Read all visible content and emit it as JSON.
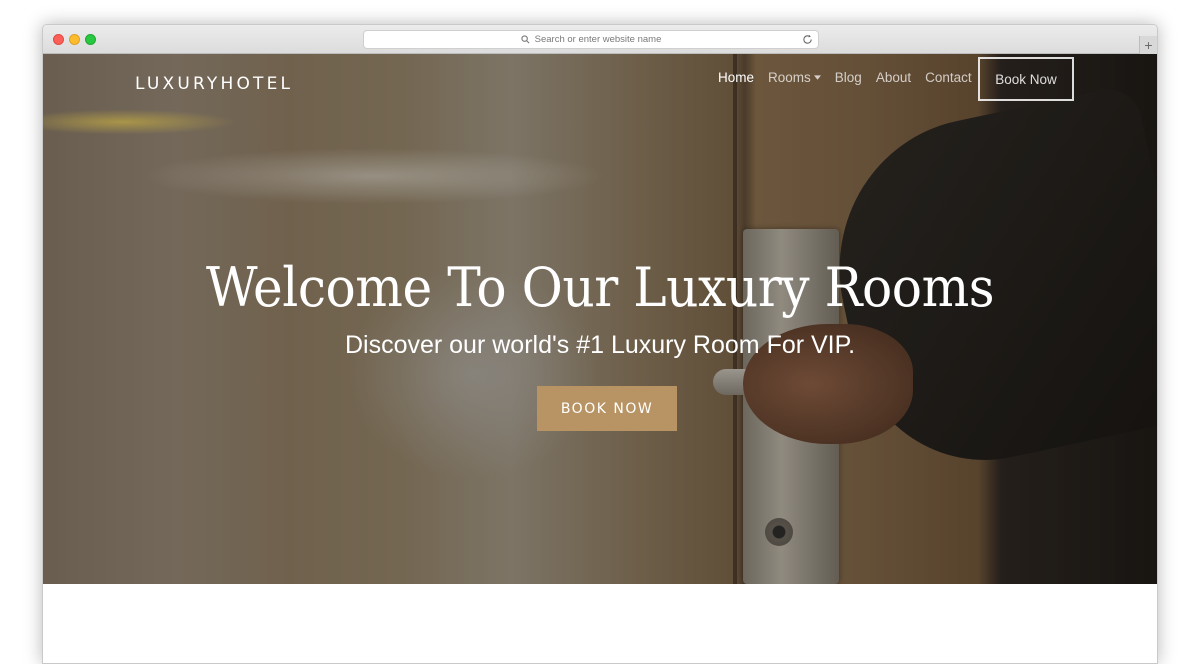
{
  "browser": {
    "url_placeholder": "Search or enter website name",
    "new_tab_label": "+"
  },
  "nav": {
    "brand": "LUXURYHOTEL",
    "items": [
      {
        "label": "Home",
        "active": true
      },
      {
        "label": "Rooms",
        "has_dropdown": true
      },
      {
        "label": "Blog"
      },
      {
        "label": "About"
      },
      {
        "label": "Contact"
      }
    ],
    "book_button": "Book Now"
  },
  "hero": {
    "title": "Welcome To Our Luxury Rooms",
    "subtitle": "Discover our world's #1 Luxury Room For VIP.",
    "cta": "BOOK NOW"
  },
  "colors": {
    "accent": "#b89465",
    "text_on_hero": "#ffffff"
  }
}
